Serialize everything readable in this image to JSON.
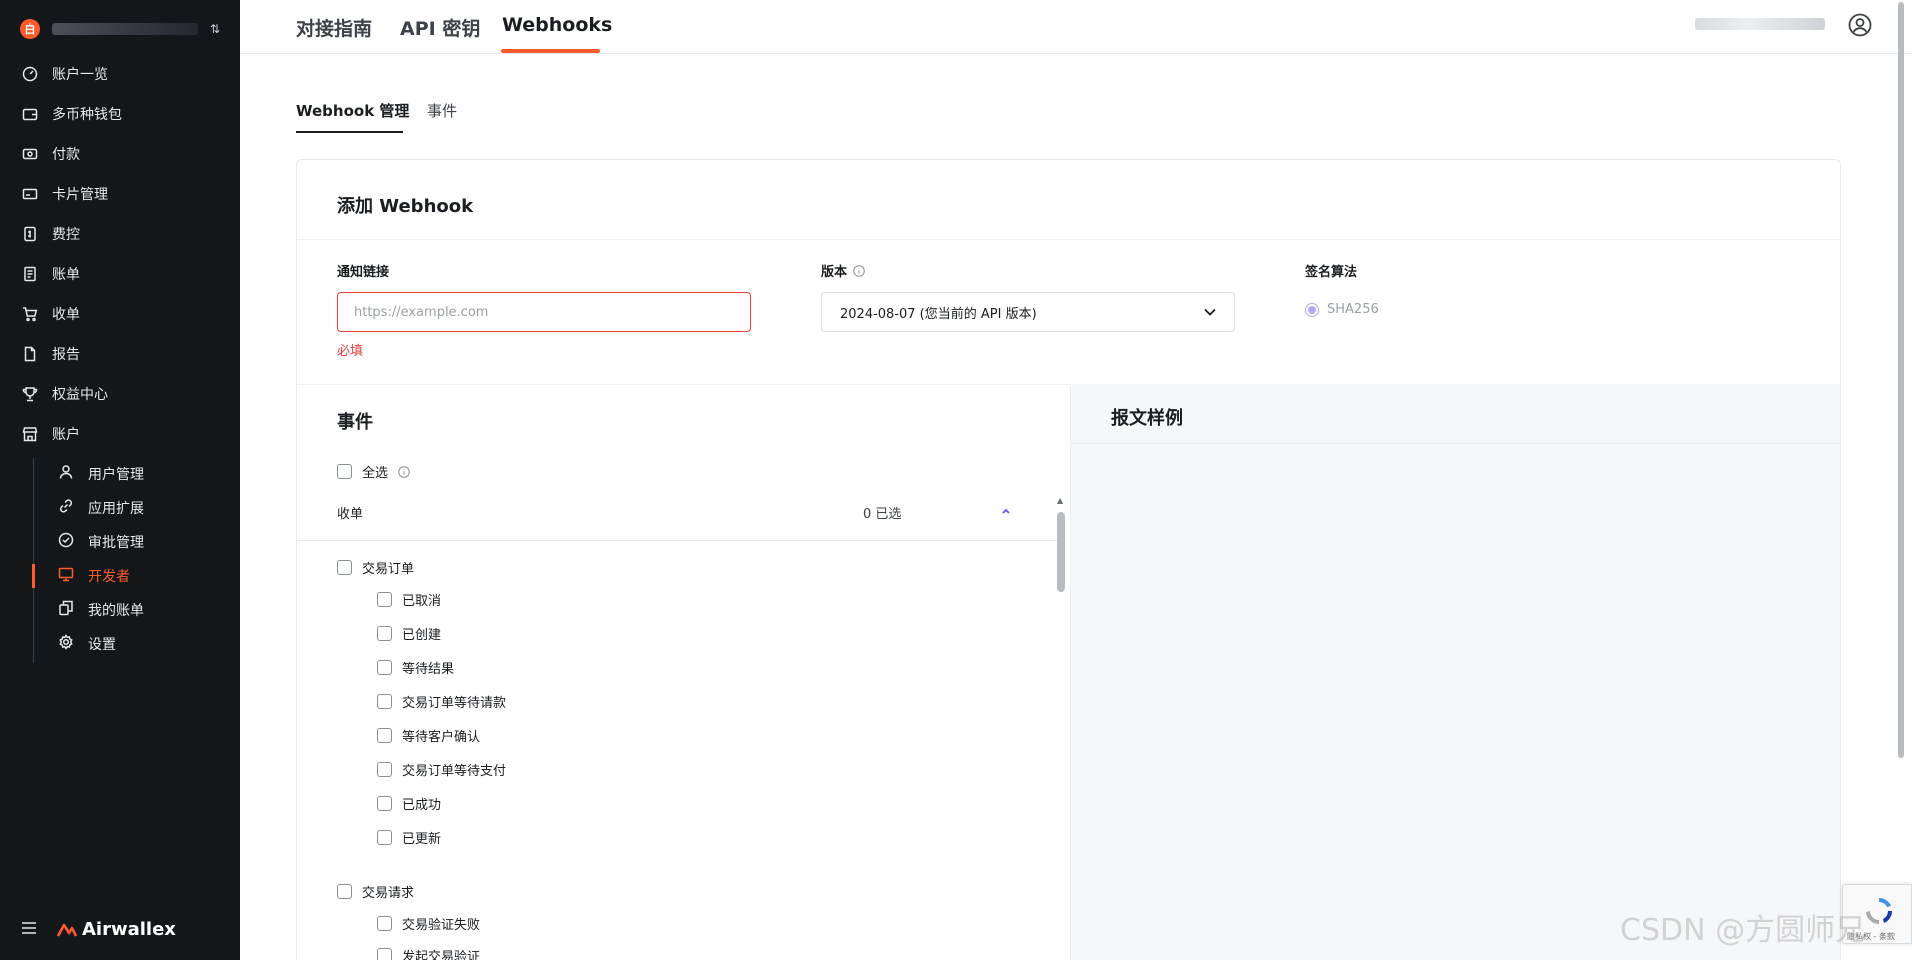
{
  "sidebar": {
    "logo_glyph": "白",
    "items": [
      {
        "label": "账户一览",
        "icon": "dashboard-icon"
      },
      {
        "label": "多币种钱包",
        "icon": "wallet-icon"
      },
      {
        "label": "付款",
        "icon": "payment-icon"
      },
      {
        "label": "卡片管理",
        "icon": "card-icon"
      },
      {
        "label": "费控",
        "icon": "expense-icon"
      },
      {
        "label": "账单",
        "icon": "bill-icon"
      },
      {
        "label": "收单",
        "icon": "cart-icon"
      },
      {
        "label": "报告",
        "icon": "report-icon"
      },
      {
        "label": "权益中心",
        "icon": "trophy-icon"
      },
      {
        "label": "账户",
        "icon": "account-icon"
      }
    ],
    "sub_items": [
      {
        "label": "用户管理",
        "icon": "user-icon"
      },
      {
        "label": "应用扩展",
        "icon": "link-icon"
      },
      {
        "label": "审批管理",
        "icon": "approval-icon"
      },
      {
        "label": "开发者",
        "icon": "developer-icon",
        "active": true
      },
      {
        "label": "我的账单",
        "icon": "my-bill-icon"
      },
      {
        "label": "设置",
        "icon": "settings-icon"
      }
    ],
    "brand": "Airwallex",
    "brand_color": "#ff5a2c"
  },
  "header": {
    "tabs": [
      {
        "label": "对接指南"
      },
      {
        "label": "API 密钥"
      },
      {
        "label": "Webhooks",
        "active": true
      }
    ]
  },
  "subtabs": [
    {
      "label": "Webhook 管理",
      "active": true
    },
    {
      "label": "事件"
    }
  ],
  "form": {
    "title": "添加 Webhook",
    "url_label": "通知链接",
    "url_placeholder": "https://example.com",
    "url_value": "",
    "required_msg": "必填",
    "version_label": "版本",
    "version_value": "2024-08-07 (您当前的 API 版本)",
    "sign_label": "签名算法",
    "sign_value": "SHA256"
  },
  "events": {
    "title": "事件",
    "select_all": "全选",
    "group": {
      "name": "收单",
      "count": "0 已选"
    },
    "parents": [
      {
        "label": "交易订单",
        "children": [
          "已取消",
          "已创建",
          "等待结果",
          "交易订单等待请款",
          "等待客户确认",
          "交易订单等待支付",
          "已成功",
          "已更新"
        ]
      },
      {
        "label": "交易请求",
        "children": [
          "交易验证失败",
          "发起交易验证"
        ]
      }
    ]
  },
  "sample": {
    "title": "报文样例"
  },
  "recaptcha": {
    "text": "隐私权 - 条款"
  },
  "watermark": "CSDN @方圆师兄",
  "colors": {
    "accent": "#ff5a2c",
    "error": "#ef3a3a",
    "sidebar_bg": "#14171a",
    "radio": "#b9a8f5"
  }
}
